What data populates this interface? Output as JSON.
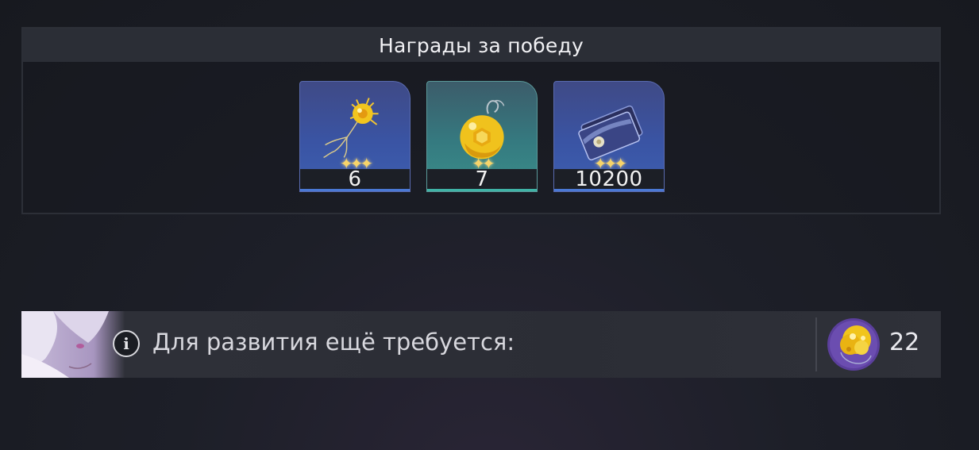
{
  "rewards": {
    "title": "Награды за победу",
    "items": [
      {
        "icon": "golden-neuron-icon",
        "stars": "✦✦✦",
        "count": "6",
        "rarity": "blue"
      },
      {
        "icon": "golden-orb-pendant-icon",
        "stars": "✦✦",
        "count": "7",
        "rarity": "teal"
      },
      {
        "icon": "credit-card-icon",
        "stars": "✦✦✦",
        "count": "10200",
        "rarity": "blue"
      }
    ]
  },
  "requirement": {
    "portrait": "character-portrait",
    "info_icon": "i",
    "text": "Для развития ещё требуется:",
    "material_icon": "golden-spore-cluster-icon",
    "material_count": "22"
  },
  "colors": {
    "blue_card": "#3a54a4",
    "teal_card": "#357a80",
    "star": "#f7d46a"
  }
}
